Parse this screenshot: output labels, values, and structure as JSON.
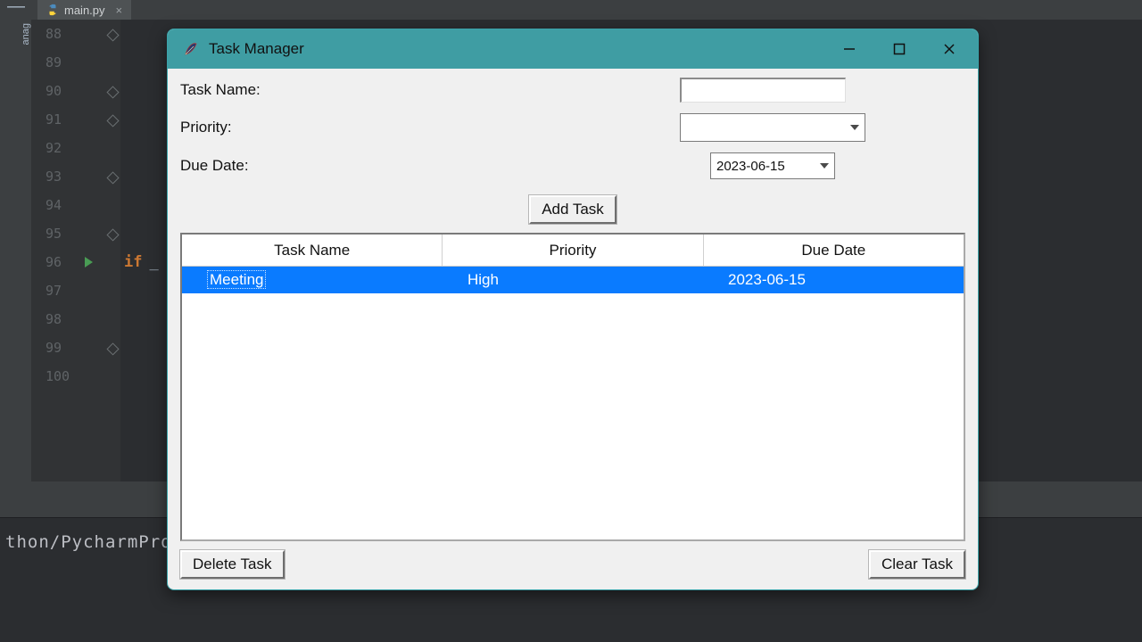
{
  "ide": {
    "tab_file": "main.py",
    "left_badge": "anag",
    "line_numbers": [
      "88",
      "89",
      "90",
      "91",
      "92",
      "93",
      "94",
      "95",
      "96",
      "97",
      "98",
      "99",
      "100"
    ],
    "code_if_keyword": "if",
    "code_after_if": "_",
    "terminal_text": "thon/PycharmProje"
  },
  "window": {
    "title": "Task Manager",
    "form": {
      "task_name_label": "Task Name:",
      "task_name_value": "",
      "priority_label": "Priority:",
      "priority_value": "",
      "due_date_label": "Due Date:",
      "due_date_value": "2023-06-15"
    },
    "buttons": {
      "add": "Add Task",
      "delete": "Delete Task",
      "clear": "Clear Task"
    },
    "tree": {
      "headers": [
        "Task Name",
        "Priority",
        "Due Date"
      ],
      "rows": [
        {
          "name": "Meeting",
          "priority": "High",
          "due": "2023-06-15",
          "selected": true
        }
      ]
    }
  }
}
